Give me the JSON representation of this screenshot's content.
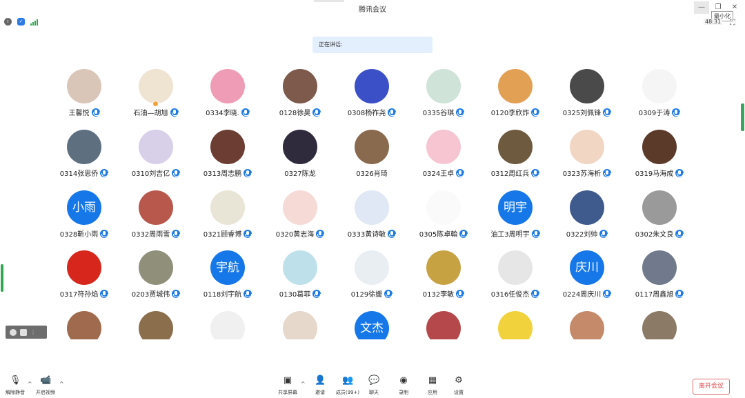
{
  "window": {
    "title": "腾讯会议",
    "tooltip": "最小化",
    "timer": "48:31"
  },
  "speaking": {
    "label": "正在讲话:"
  },
  "participants": [
    {
      "name": "王馨悦",
      "avatar_color": "#d9c6b8",
      "mic": true
    },
    {
      "name": "石油—胡旭",
      "avatar_color": "#efe3d2",
      "mic": true,
      "badge": true
    },
    {
      "name": "0334李晓.",
      "avatar_color": "#ef9db6",
      "mic": true
    },
    {
      "name": "0128徐昊",
      "avatar_color": "#7d5a4b",
      "mic": true
    },
    {
      "name": "0308杨祚尧",
      "avatar_color": "#3b4fc7",
      "mic": true
    },
    {
      "name": "0335谷琪",
      "avatar_color": "#cfe3d9",
      "mic": true
    },
    {
      "name": "0120李欣炸",
      "avatar_color": "#e2a055",
      "mic": true
    },
    {
      "name": "0325刘佩锋",
      "avatar_color": "#4a4a4a",
      "mic": true
    },
    {
      "name": "0309于涛",
      "avatar_color": "#f5f5f5",
      "mic": true
    },
    {
      "name": "0314张思侨",
      "avatar_color": "#5e6f80",
      "mic": true
    },
    {
      "name": "0310刘吉亿",
      "avatar_color": "#d8cfe9",
      "mic": true
    },
    {
      "name": "0313周志鹏",
      "avatar_color": "#6b3d33",
      "mic": true
    },
    {
      "name": "0327陈龙",
      "avatar_color": "#2f2a3c",
      "mic": false
    },
    {
      "name": "0326肖琦",
      "avatar_color": "#8a6a4e",
      "mic": false
    },
    {
      "name": "0324王卓",
      "avatar_color": "#f6c5d1",
      "mic": true
    },
    {
      "name": "0312周红兵",
      "avatar_color": "#6e5a3f",
      "mic": true
    },
    {
      "name": "0323苏海析",
      "avatar_color": "#f2d6c4",
      "mic": true
    },
    {
      "name": "0319马海成",
      "avatar_color": "#5b3a2a",
      "mic": true
    },
    {
      "name": "0328靳小雨",
      "avatar_text": "小雨",
      "mic": true
    },
    {
      "name": "0332周雨雪",
      "avatar_color": "#b8574b",
      "mic": true
    },
    {
      "name": "0321顾睿博",
      "avatar_color": "#e9e5d6",
      "mic": true
    },
    {
      "name": "0320黄志海",
      "avatar_color": "#f5dad6",
      "mic": true
    },
    {
      "name": "0333黄诗敏",
      "avatar_color": "#dfe8f4",
      "mic": true
    },
    {
      "name": "0305陈卓翰",
      "avatar_color": "#fafafa",
      "mic": true
    },
    {
      "name": "油工3周明宇",
      "avatar_text": "明宇",
      "mic": true
    },
    {
      "name": "0322刘帅",
      "avatar_color": "#3f5b8e",
      "mic": true
    },
    {
      "name": "0302朱文良",
      "avatar_color": "#9a9a9a",
      "mic": true
    },
    {
      "name": "0317符孙焰",
      "avatar_color": "#d7261c",
      "mic": true
    },
    {
      "name": "0203贾城伟",
      "avatar_color": "#8f8f7a",
      "mic": true
    },
    {
      "name": "0118刘宇航",
      "avatar_text": "宇航",
      "mic": true
    },
    {
      "name": "0130葛菲",
      "avatar_color": "#bde0ea",
      "mic": true
    },
    {
      "name": "0129徐媛",
      "avatar_color": "#e9eef3",
      "mic": true
    },
    {
      "name": "0132李敏",
      "avatar_color": "#c7a243",
      "mic": true
    },
    {
      "name": "0316任俊杰",
      "avatar_color": "#e6e6e6",
      "mic": true
    },
    {
      "name": "0224周庆川",
      "avatar_text": "庆川",
      "mic": true
    },
    {
      "name": "0117周鑫旭",
      "avatar_color": "#707a8c",
      "mic": true
    },
    {
      "name": "",
      "avatar_color": "#a06a4e",
      "mic": false
    },
    {
      "name": "",
      "avatar_color": "#8b6e4c",
      "mic": false
    },
    {
      "name": "",
      "avatar_color": "#f0f0f0",
      "mic": false
    },
    {
      "name": "",
      "avatar_color": "#e7d8cc",
      "mic": false
    },
    {
      "name": "",
      "avatar_text": "文杰",
      "mic": false
    },
    {
      "name": "",
      "avatar_color": "#b5484a",
      "mic": false
    },
    {
      "name": "",
      "avatar_color": "#f2d23c",
      "mic": false
    },
    {
      "name": "",
      "avatar_color": "#c48a6a",
      "mic": false
    },
    {
      "name": "",
      "avatar_color": "#8a7a66",
      "mic": false
    }
  ],
  "toolbar": {
    "unmute": "解除静音",
    "start_video": "开启视频",
    "share_screen": "共享屏幕",
    "invite": "邀请",
    "members": "成员(99+)",
    "chat": "聊天",
    "record": "录制",
    "apps": "应用",
    "settings": "设置",
    "leave": "离开会议"
  },
  "icons": {
    "info": "info-icon",
    "shield": "shield-icon",
    "signal": "signal-icon",
    "minimize": "minimize-icon",
    "restore": "restore-icon",
    "close": "close-icon",
    "expand": "expand-icon"
  },
  "colors": {
    "accent": "#1677e8",
    "leave": "#e04444",
    "speaking_bg": "#e4effd"
  }
}
